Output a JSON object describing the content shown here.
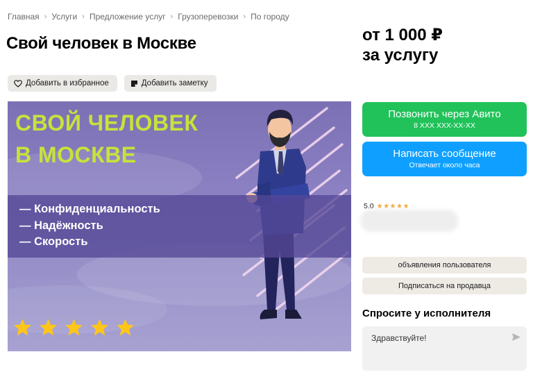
{
  "breadcrumbs": [
    "Главная",
    "Услуги",
    "Предложение услуг",
    "Грузоперевозки",
    "По городу"
  ],
  "title": "Свой человек в Москве",
  "actions": {
    "favorite_label": "Добавить в избранное",
    "favorite_icon": "heart-icon",
    "note_label": "Добавить заметку",
    "note_icon": "note-icon"
  },
  "price": {
    "line1": "от 1 000 ₽",
    "line2": "за услугу"
  },
  "banner": {
    "heading_line1": "СВОЙ ЧЕЛОВЕК",
    "heading_line2": "В МОСКВЕ",
    "items": [
      "— Конфиденциальность",
      "— Надёжность",
      "— Скорость"
    ],
    "star_count": 5,
    "star_color": "#ffc61a",
    "heading_color": "#c7e33a"
  },
  "call_button": {
    "label": "Позвонить через Авито",
    "sub": "8 XXX XXX-XX-XX",
    "color": "#21c25a"
  },
  "message_button": {
    "label": "Написать сообщение",
    "sub": "Отвечает около часа",
    "color": "#0fa0ff"
  },
  "rating": {
    "value": "5.0",
    "stars": "★★★★★"
  },
  "seller_buttons": {
    "ads_label": "объявления пользователя",
    "subscribe_label": "Подписаться на продавца"
  },
  "ask": {
    "title": "Спросите у исполнителя",
    "input_value": "Здравствуйте!",
    "send_icon": "send-icon"
  }
}
